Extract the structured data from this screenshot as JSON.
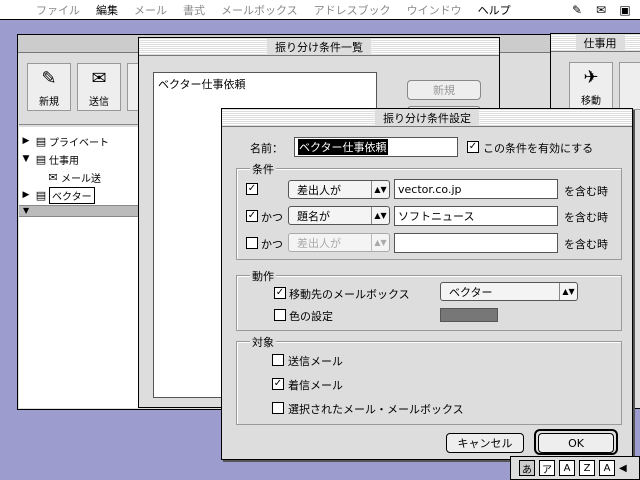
{
  "menubar": {
    "items": [
      {
        "label": "ファイル",
        "enabled": false
      },
      {
        "label": "編集",
        "enabled": true
      },
      {
        "label": "メール",
        "enabled": false
      },
      {
        "label": "書式",
        "enabled": false
      },
      {
        "label": "メールボックス",
        "enabled": false
      },
      {
        "label": "アドレスブック",
        "enabled": false
      },
      {
        "label": "ウインドウ",
        "enabled": false
      },
      {
        "label": "ヘルプ",
        "enabled": true
      }
    ]
  },
  "main_window": {
    "toolbar": [
      {
        "label": "新規",
        "icon": "compose-icon"
      },
      {
        "label": "送信",
        "icon": "send-icon"
      }
    ],
    "folders": [
      {
        "label": "プライベート",
        "expanded": false
      },
      {
        "label": "仕事用",
        "expanded": true
      },
      {
        "label": "メール送",
        "child": true
      },
      {
        "label": "ベクター",
        "editing": true
      }
    ]
  },
  "right_window": {
    "title": "仕事用",
    "toolbar_label": "移動"
  },
  "rules_list_window": {
    "title": "振り分け条件一覧",
    "rules": [
      "ベクター仕事依頼"
    ],
    "new_button": "新規"
  },
  "dialog": {
    "title": "振り分け条件設定",
    "name_label": "名前：",
    "name_value": "ベクター仕事依頼",
    "enable_label": "この条件を有効にする",
    "enable_checked": true,
    "conditions_title": "条件",
    "conditions": [
      {
        "checked": true,
        "connector": "",
        "field": "差出人が",
        "value": "vector.co.jp",
        "suffix": "を含む時",
        "enabled": true
      },
      {
        "checked": true,
        "connector": "かつ",
        "field": "題名が",
        "value": "ソフトニュース",
        "suffix": "を含む時",
        "enabled": true
      },
      {
        "checked": false,
        "connector": "かつ",
        "field": "差出人が",
        "value": "",
        "suffix": "を含む時",
        "enabled": false
      }
    ],
    "action_title": "動作",
    "move_label": "移動先のメールボックス",
    "move_checked": true,
    "move_target": "ベクター",
    "color_label": "色の設定",
    "color_checked": false,
    "color_value": "#777777",
    "target_title": "対象",
    "targets": [
      {
        "label": "送信メール",
        "checked": false
      },
      {
        "label": "着信メール",
        "checked": true
      },
      {
        "label": "選択されたメール・メールボックス",
        "checked": false
      }
    ],
    "cancel_button": "キャンセル",
    "ok_button": "OK"
  },
  "ime_palette": [
    "あ",
    "ア",
    "A",
    "Z",
    "A"
  ]
}
